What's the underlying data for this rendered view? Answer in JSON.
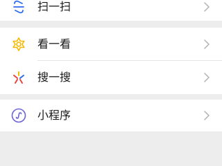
{
  "discover": {
    "items": [
      {
        "label": "扫一扫",
        "icon": "scan-icon",
        "color": "#2b6af0"
      },
      {
        "label": "看一看",
        "icon": "look-icon",
        "color": "#f5b700"
      },
      {
        "label": "搜一搜",
        "icon": "search-icon",
        "color": "#e8453c"
      },
      {
        "label": "小程序",
        "icon": "mini-program-icon",
        "color": "#6b63d8"
      }
    ]
  },
  "colors": {
    "background": "#ededed",
    "card": "#ffffff",
    "chevron": "#b2b2b2",
    "text": "#191919"
  }
}
